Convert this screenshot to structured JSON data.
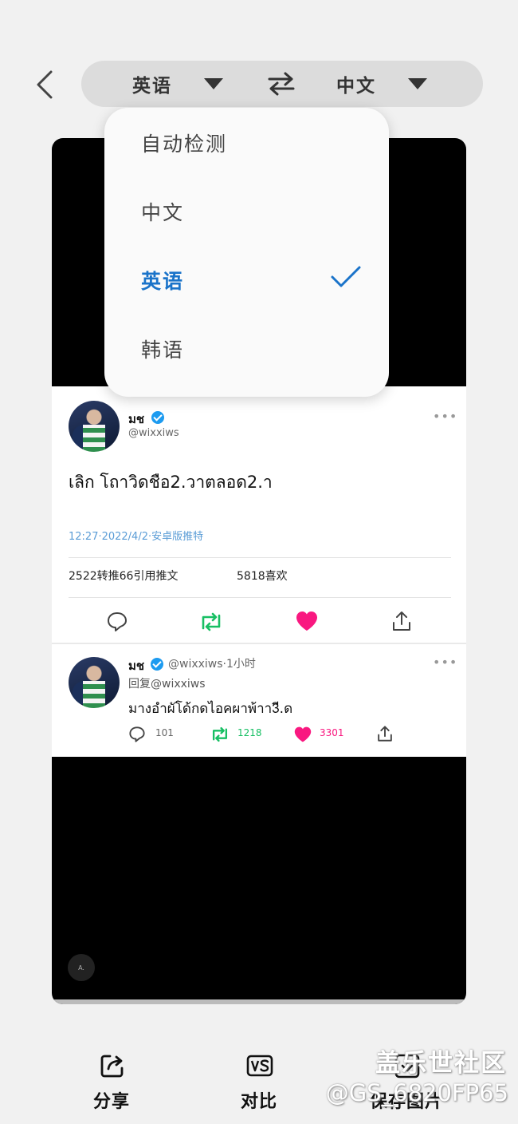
{
  "header": {
    "source_lang": "英语",
    "target_lang": "中文",
    "icons": [
      "back-icon",
      "chevron-down-icon",
      "swap-icon"
    ]
  },
  "dropdown": {
    "items": [
      {
        "label": "自动检测",
        "selected": false
      },
      {
        "label": "中文",
        "selected": false
      },
      {
        "label": "英语",
        "selected": true
      },
      {
        "label": "韩语",
        "selected": false
      }
    ],
    "accent_color": "#1a73c9"
  },
  "tweet": {
    "name": "มช",
    "handle": "@wixxiws",
    "text": "เลิก โถาวิดชือ2.วาตลอด2.า",
    "meta": "12:27·2022/4/2·安卓版推特",
    "stats_left": "2522转推66引用推文",
    "stats_right": "5818喜欢"
  },
  "reply": {
    "name": "มช",
    "handle_time": "@wixxiws·1小时",
    "reply_to": "回复@wixxiws",
    "text": "มางอำผัโด้กดไอคผาพ้าา3ี.ด",
    "comments": "101",
    "retweets": "1218",
    "likes": "3301"
  },
  "preview": {
    "badge": "A."
  },
  "bottom_bar": {
    "share": "分享",
    "compare": "对比",
    "save": "保存图片"
  },
  "watermark": {
    "line1": "盖乐世社区",
    "line2": "@GS_6820FP65"
  },
  "colors": {
    "retweet_green": "#17bf63",
    "like_pink": "#f91880",
    "verified_blue": "#1d9bf0"
  }
}
